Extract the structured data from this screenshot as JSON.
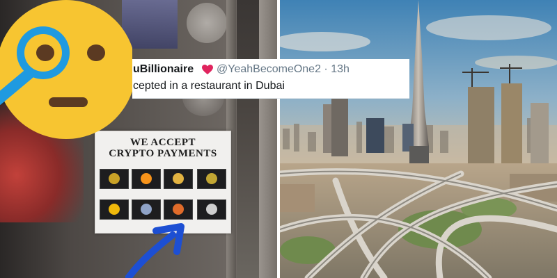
{
  "tweet": {
    "display_name": "uBillionaire",
    "handle_time": "@YeahBecomeOne2 · 13h",
    "text": "cepted in a restaurant in Dubai"
  },
  "sign": {
    "title_line1": "WE ACCEPT",
    "title_line2": "CRYPTO PAYMENTS",
    "coins": [
      {
        "icon": "coin-icon",
        "color": "#c9a227"
      },
      {
        "icon": "bitcoin-icon",
        "color": "#f7931a"
      },
      {
        "icon": "coin-icon",
        "color": "#e3b341"
      },
      {
        "icon": "dogecoin-icon",
        "color": "#c2a633"
      },
      {
        "icon": "coin-icon",
        "color": "#f0b90b"
      },
      {
        "icon": "coin-icon",
        "color": "#8fa3c8"
      },
      {
        "icon": "shiba-icon",
        "color": "#e06b2a"
      },
      {
        "icon": "coin-icon",
        "color": "#cfcfcf"
      }
    ]
  },
  "colors": {
    "emoji_face": "#f7c531",
    "magnifier": "#1f9ae0",
    "arrow": "#1d4fd3",
    "heart": "#e0245e"
  }
}
